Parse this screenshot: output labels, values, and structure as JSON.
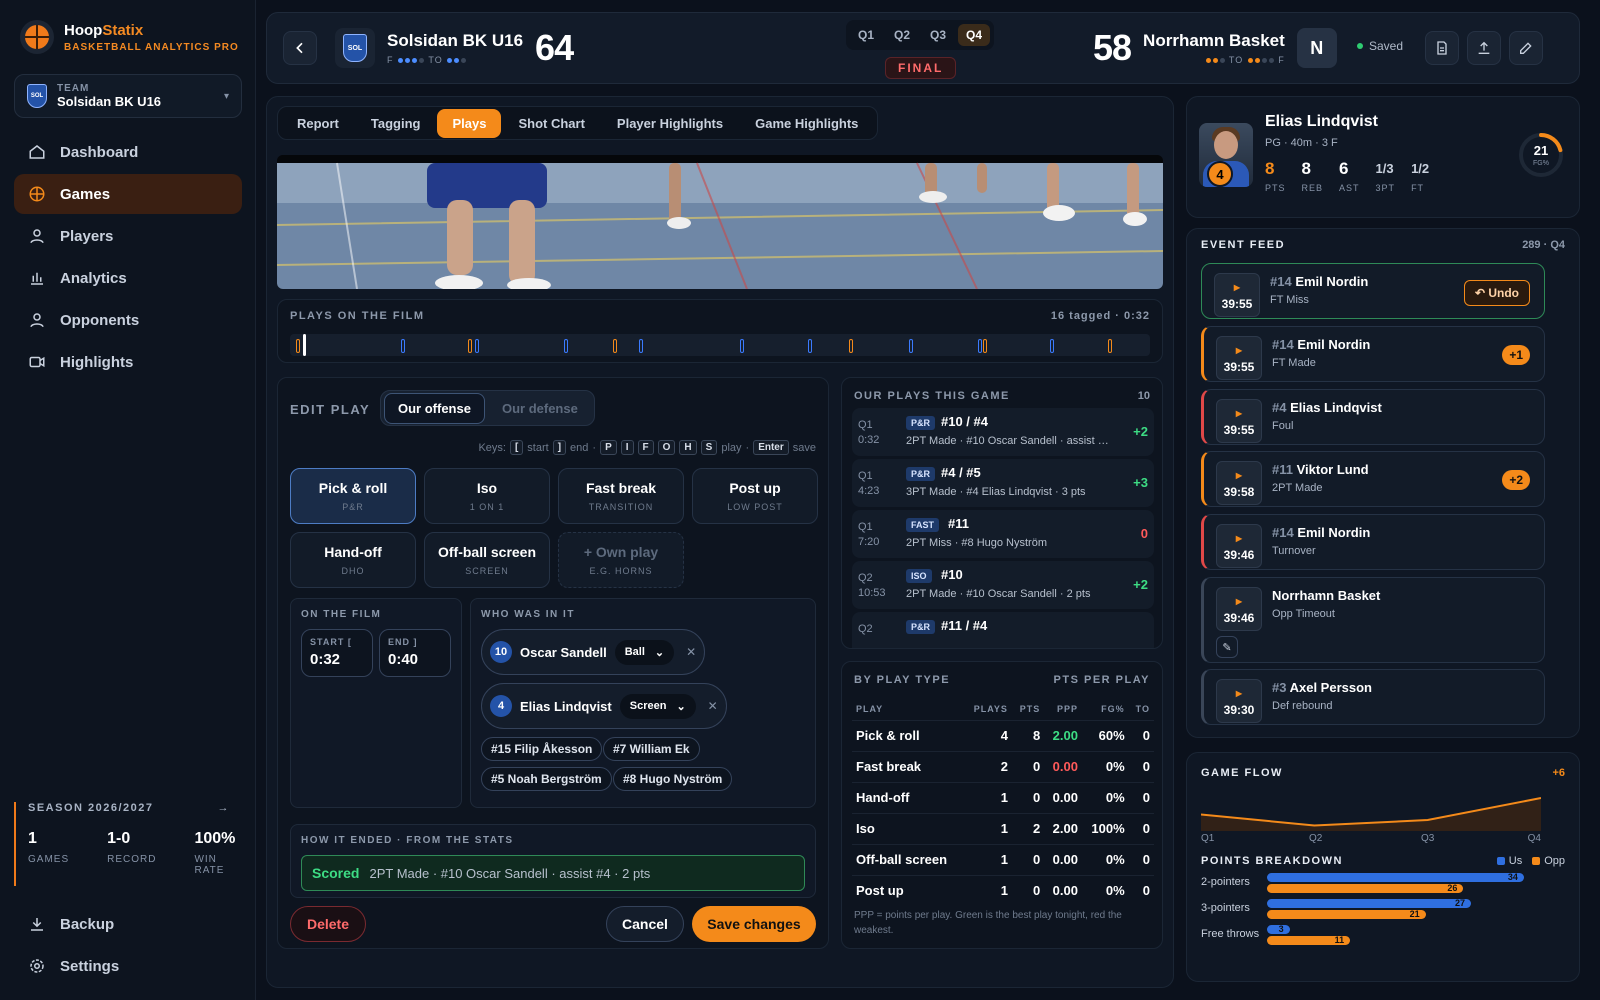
{
  "brand": {
    "name_a": "Hoop",
    "name_b": "Statix",
    "subtitle": "BASKETBALL ANALYTICS PRO"
  },
  "team_selector": {
    "label": "TEAM",
    "value": "Solsidan BK U16"
  },
  "nav": [
    {
      "label": "Dashboard",
      "icon": "home-icon"
    },
    {
      "label": "Games",
      "icon": "basketball-icon"
    },
    {
      "label": "Players",
      "icon": "user-icon"
    },
    {
      "label": "Analytics",
      "icon": "bar-chart-icon"
    },
    {
      "label": "Opponents",
      "icon": "user-icon"
    },
    {
      "label": "Highlights",
      "icon": "video-icon"
    }
  ],
  "season": {
    "title": "SEASON 2026/2027",
    "games": "1",
    "games_label": "GAMES",
    "record": "1-0",
    "record_label": "RECORD",
    "win_rate": "100%",
    "win_rate_label": "WIN RATE"
  },
  "bottom_nav": [
    {
      "label": "Backup",
      "icon": "download-icon"
    },
    {
      "label": "Settings",
      "icon": "gear-icon"
    }
  ],
  "scoreboard": {
    "home": {
      "name": "Solsidan BK U16",
      "score": "64",
      "badge": "SOL",
      "fouls_label": "F",
      "to_label": "TO"
    },
    "away": {
      "name": "Norrhamn Basket",
      "score": "58",
      "badge": "N",
      "fouls_label": "F",
      "to_label": "TO"
    },
    "quarters": [
      "Q1",
      "Q2",
      "Q3",
      "Q4"
    ],
    "active_quarter": "Q4",
    "status": "FINAL",
    "saved": "Saved"
  },
  "tabs": [
    "Report",
    "Tagging",
    "Plays",
    "Shot Chart",
    "Player Highlights",
    "Game Highlights"
  ],
  "active_tab": "Plays",
  "film": {
    "title": "PLAYS ON THE FILM",
    "summary": "16 tagged · 0:32"
  },
  "edit_play": {
    "title": "EDIT PLAY",
    "modes": [
      "Our offense",
      "Our defense"
    ],
    "keys": {
      "label": "Keys:",
      "k1": "[",
      "t1": "start",
      "k2": "]",
      "t2": "end",
      "k3": "P",
      "k4": "I",
      "k5": "F",
      "k6": "O",
      "k7": "H",
      "k8": "S",
      "t3": "play",
      "k9": "Enter",
      "t4": "save"
    },
    "play_types": [
      {
        "name": "Pick & roll",
        "sub": "P&R"
      },
      {
        "name": "Iso",
        "sub": "1 ON 1"
      },
      {
        "name": "Fast break",
        "sub": "TRANSITION"
      },
      {
        "name": "Post up",
        "sub": "LOW POST"
      },
      {
        "name": "Hand-off",
        "sub": "DHO"
      },
      {
        "name": "Off-ball screen",
        "sub": "SCREEN"
      },
      {
        "name": "+ Own play",
        "sub": "E.G. HORNS"
      }
    ],
    "on_film": {
      "title": "ON THE FILM",
      "start_label": "START [",
      "start": "0:32",
      "end_label": "END ]",
      "end": "0:40"
    },
    "who": {
      "title": "WHO WAS IN IT",
      "players": [
        {
          "num": "10",
          "name": "Oscar Sandell",
          "role": "Ball"
        },
        {
          "num": "4",
          "name": "Elias Lindqvist",
          "role": "Screen"
        }
      ],
      "bench": [
        "#15 Filip Åkesson",
        "#7 William Ek",
        "#5 Noah Bergström",
        "#8 Hugo Nyström"
      ]
    },
    "ended": {
      "title": "HOW IT ENDED · FROM THE STATS",
      "result": "Scored",
      "detail": "2PT Made · #10 Oscar Sandell · assist #4 · 2 pts"
    },
    "delete": "Delete",
    "cancel": "Cancel",
    "save": "Save changes"
  },
  "our_plays": {
    "title": "OUR PLAYS THIS GAME",
    "count": "10",
    "rows": [
      {
        "q": "Q1",
        "t": "0:32",
        "tag": "P&R",
        "who": "#10 / #4",
        "desc": "2PT Made · #10 Oscar Sandell · assist …",
        "pts": "+2"
      },
      {
        "q": "Q1",
        "t": "4:23",
        "tag": "P&R",
        "who": "#4 / #5",
        "desc": "3PT Made · #4 Elias Lindqvist · 3 pts",
        "pts": "+3"
      },
      {
        "q": "Q1",
        "t": "7:20",
        "tag": "FAST",
        "who": "#11",
        "desc": "2PT Miss · #8 Hugo Nyström",
        "pts": "0"
      },
      {
        "q": "Q2",
        "t": "10:53",
        "tag": "ISO",
        "who": "#10",
        "desc": "2PT Made · #10 Oscar Sandell · 2 pts",
        "pts": "+2"
      },
      {
        "q": "Q2",
        "t": "",
        "tag": "P&R",
        "who": "#11 / #4",
        "desc": "",
        "pts": ""
      }
    ]
  },
  "by_type": {
    "title": "BY PLAY TYPE",
    "subtitle": "PTS PER PLAY",
    "headers": [
      "PLAY",
      "PLAYS",
      "PTS",
      "PPP",
      "FG%",
      "TO"
    ],
    "rows": [
      [
        "Pick & roll",
        "4",
        "8",
        "2.00",
        "60%",
        "0"
      ],
      [
        "Fast break",
        "2",
        "0",
        "0.00",
        "0%",
        "0"
      ],
      [
        "Hand-off",
        "1",
        "0",
        "0.00",
        "0%",
        "0"
      ],
      [
        "Iso",
        "1",
        "2",
        "2.00",
        "100%",
        "0"
      ],
      [
        "Off-ball screen",
        "1",
        "0",
        "0.00",
        "0%",
        "0"
      ],
      [
        "Post up",
        "1",
        "0",
        "0.00",
        "0%",
        "0"
      ]
    ],
    "note": "PPP = points per play. Green is the best play tonight, red the weakest."
  },
  "player_card": {
    "name": "Elias Lindqvist",
    "meta": "PG · 40m · 3 F",
    "number": "4",
    "stats": [
      {
        "v": "8",
        "l": "PTS"
      },
      {
        "v": "8",
        "l": "REB"
      },
      {
        "v": "6",
        "l": "AST"
      },
      {
        "v": "1/3",
        "l": "3PT"
      },
      {
        "v": "1/2",
        "l": "FT"
      }
    ],
    "fg_value": "21",
    "fg_label": "FG%",
    "fg_fraction": 0.21
  },
  "event_feed": {
    "title": "EVENT FEED",
    "summary": "289 · Q4",
    "events": [
      {
        "time": "39:55",
        "num": "#14",
        "name": "Emil Nordin",
        "what": "FT Miss",
        "action": "Undo",
        "accent": "#2e8a57"
      },
      {
        "time": "39:55",
        "num": "#14",
        "name": "Emil Nordin",
        "what": "FT Made",
        "badge": "+1",
        "accent": "#f48a1a"
      },
      {
        "time": "39:55",
        "num": "#4",
        "name": "Elias Lindqvist",
        "what": "Foul",
        "accent": "#e04848"
      },
      {
        "time": "39:58",
        "num": "#11",
        "name": "Viktor Lund",
        "what": "2PT Made",
        "badge": "+2",
        "accent": "#f48a1a"
      },
      {
        "time": "39:46",
        "num": "#14",
        "name": "Emil Nordin",
        "what": "Turnover",
        "accent": "#e04848"
      },
      {
        "time": "39:46",
        "num": "",
        "name": "Norrhamn Basket",
        "what": "Opp Timeout",
        "accent": "#3a4658"
      },
      {
        "time": "39:30",
        "num": "#3",
        "name": "Axel Persson",
        "what": "Def rebound",
        "accent": "#3a4658"
      }
    ]
  },
  "game_flow": {
    "title": "GAME FLOW",
    "lead": "+6",
    "ticks": [
      "Q1",
      "Q2",
      "Q3",
      "Q4"
    ]
  },
  "points_breakdown": {
    "title": "POINTS BREAKDOWN",
    "legend_us": "Us",
    "legend_opp": "Opp",
    "us_color": "#2f6fe0",
    "opp_color": "#f48a1a"
  },
  "chart_data": [
    {
      "type": "line",
      "title": "GAME FLOW",
      "categories": [
        "Q1",
        "Q2",
        "Q3",
        "Q4"
      ],
      "series": [
        {
          "values": [
            3,
            1,
            2,
            6
          ]
        }
      ]
    },
    {
      "type": "bar",
      "title": "POINTS BREAKDOWN",
      "categories": [
        "2-pointers",
        "3-pointers",
        "Free throws"
      ],
      "series": [
        {
          "name": "Us",
          "values": [
            34,
            27,
            3
          ]
        },
        {
          "name": "Opp",
          "values": [
            26,
            21,
            11
          ]
        }
      ],
      "xlim": [
        0,
        36
      ]
    }
  ]
}
